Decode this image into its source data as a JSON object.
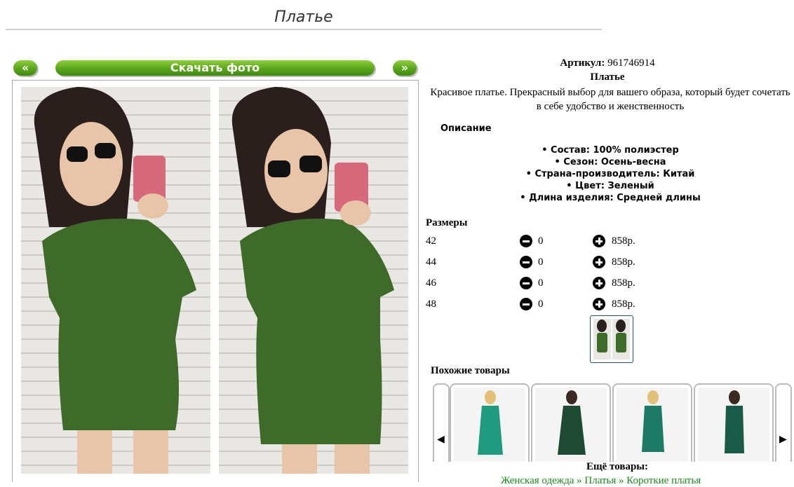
{
  "page": {
    "title": "Платье"
  },
  "gallery": {
    "prev_label": "«",
    "next_label": "»",
    "download_label": "Скачать фото"
  },
  "product": {
    "sku_label": "Артикул:",
    "sku_value": "961746914",
    "name": "Платье",
    "description": "Красивое платье. Прекрасный выбор для вашего образа, который будет сочетать в себе удобство и женственность",
    "details_title": "Описание",
    "specs": [
      "Состав: 100% полиэстер",
      "Сезон: Осень-весна",
      "Страна-производитель: Китай",
      "Цвет: Зеленый",
      "Длина изделия: Средней длины"
    ]
  },
  "sizes": {
    "title": "Размеры",
    "rows": [
      {
        "size": "42",
        "qty": "0",
        "price": "858р."
      },
      {
        "size": "44",
        "qty": "0",
        "price": "858р."
      },
      {
        "size": "46",
        "qty": "0",
        "price": "858р."
      },
      {
        "size": "48",
        "qty": "0",
        "price": "858р."
      }
    ]
  },
  "similar": {
    "title": "Похожие товары",
    "left_arrow": "◀",
    "right_arrow": "▶",
    "items": [
      {
        "color": "#1f9a7e"
      },
      {
        "color": "#1e4a34"
      },
      {
        "color": "#1d7a66"
      },
      {
        "color": "#1a5a48"
      }
    ]
  },
  "more": {
    "title": "Ещё товары:",
    "links": "Женская одежда » Платья » Короткие платья"
  },
  "colors": {
    "accent": "#5aa51b",
    "dress": "#3f6b2a",
    "link": "#1a8a1a"
  }
}
